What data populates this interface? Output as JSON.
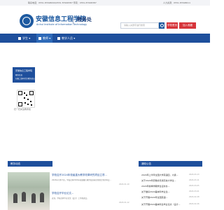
{
  "topbar": {
    "left": "联系电话：0551-87998099/0551 87998387   传真：0551-87998387",
    "right": "人力资源：0551-87998611"
  },
  "header": {
    "school_name_cn": "安徽信息工程学院",
    "school_name_en": "Anhui Institute of Information Technology",
    "dept": "教务处",
    "search_placeholder": "请输入关键字进行搜索",
    "home_btn": "学校首页",
    "fav_btn": "加入收藏"
  },
  "nav": {
    "items": [
      {
        "label": "学生"
      },
      {
        "label": "教师"
      },
      {
        "label": "教学人员"
      }
    ]
  },
  "sidebar": {
    "banner_title": "安徽信息工程学院",
    "banner_line2": "教务信息",
    "banner_line3": "扫描二维码关注教务处公众号",
    "qr_caption": "扫一扫关注教务处"
  },
  "sections": {
    "news_title": "教务动态",
    "notice_title": "通知公告"
  },
  "news": [
    {
      "title": "学校召开2024年校级重大教学改革研究项目立项...",
      "sub": "2024年1月17日，学校召开2024年校级重大教学改革研究项目立项评审会...",
      "date": "2024-01-19"
    },
    {
      "title": "学校召开毕业论文...",
      "sub": "近日，学校召开毕业论文（设计）工作推进会。",
      "date": "2024-01-12"
    }
  ],
  "notices": [
    {
      "title": "2024年上半年全国大学英语四、六级...",
      "date": "2024-03-13"
    },
    {
      "title": "关于2024年安徽省普通高校大学生...",
      "date": "2024-03-11"
    },
    {
      "title": "2024年春季学期学生证补办...",
      "date": "2024-03-05"
    },
    {
      "title": "关于做好2024届本科毕业生...",
      "date": "2024-03-01"
    },
    {
      "title": "关于开展2024年全国英语...",
      "date": "2024-02-28"
    },
    {
      "title": "关于开展2024届本科生毕业论文（设计...",
      "date": "2024-02-26"
    }
  ]
}
